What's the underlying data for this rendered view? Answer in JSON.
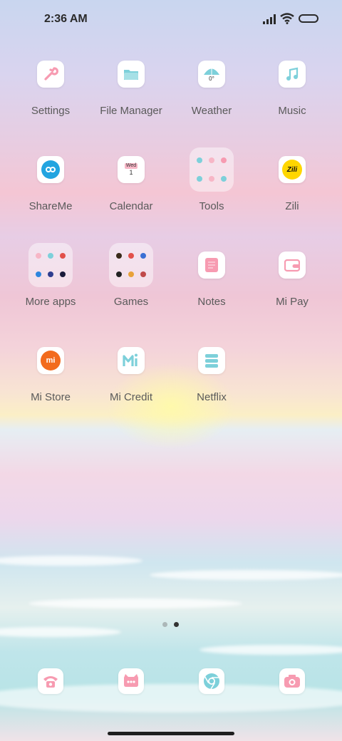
{
  "status_bar": {
    "time": "2:36 AM"
  },
  "apps": [
    {
      "label": "Settings",
      "icon": "wrench-icon"
    },
    {
      "label": "File Manager",
      "icon": "folder-icon"
    },
    {
      "label": "Weather",
      "icon": "umbrella-icon",
      "icon_text": "0°"
    },
    {
      "label": "Music",
      "icon": "music-note-icon"
    },
    {
      "label": "ShareMe",
      "icon": "infinity-icon"
    },
    {
      "label": "Calendar",
      "icon": "calendar-icon",
      "icon_day": "Wed",
      "icon_date": "1"
    },
    {
      "label": "Tools",
      "icon": "folder-icon"
    },
    {
      "label": "Zili",
      "icon": "zili-logo-icon",
      "icon_text": "Zili"
    },
    {
      "label": "More apps",
      "icon": "folder-icon"
    },
    {
      "label": "Games",
      "icon": "folder-icon"
    },
    {
      "label": "Notes",
      "icon": "notes-icon"
    },
    {
      "label": "Mi Pay",
      "icon": "wallet-icon"
    },
    {
      "label": "Mi Store",
      "icon": "mi-logo-icon",
      "icon_text": "mi"
    },
    {
      "label": "Mi Credit",
      "icon": "mi-credit-icon"
    },
    {
      "label": "Netflix",
      "icon": "server-stack-icon"
    }
  ],
  "dock": [
    {
      "icon": "phone-icon"
    },
    {
      "icon": "messages-icon"
    },
    {
      "icon": "browser-icon"
    },
    {
      "icon": "camera-icon"
    }
  ],
  "page_indicator": {
    "pages": 2,
    "current": 2
  },
  "colors": {
    "accent_pink": "#f79bb1",
    "accent_blue": "#7dd0da",
    "mi_orange": "#f26b1d",
    "label": "#5a5a5a"
  }
}
